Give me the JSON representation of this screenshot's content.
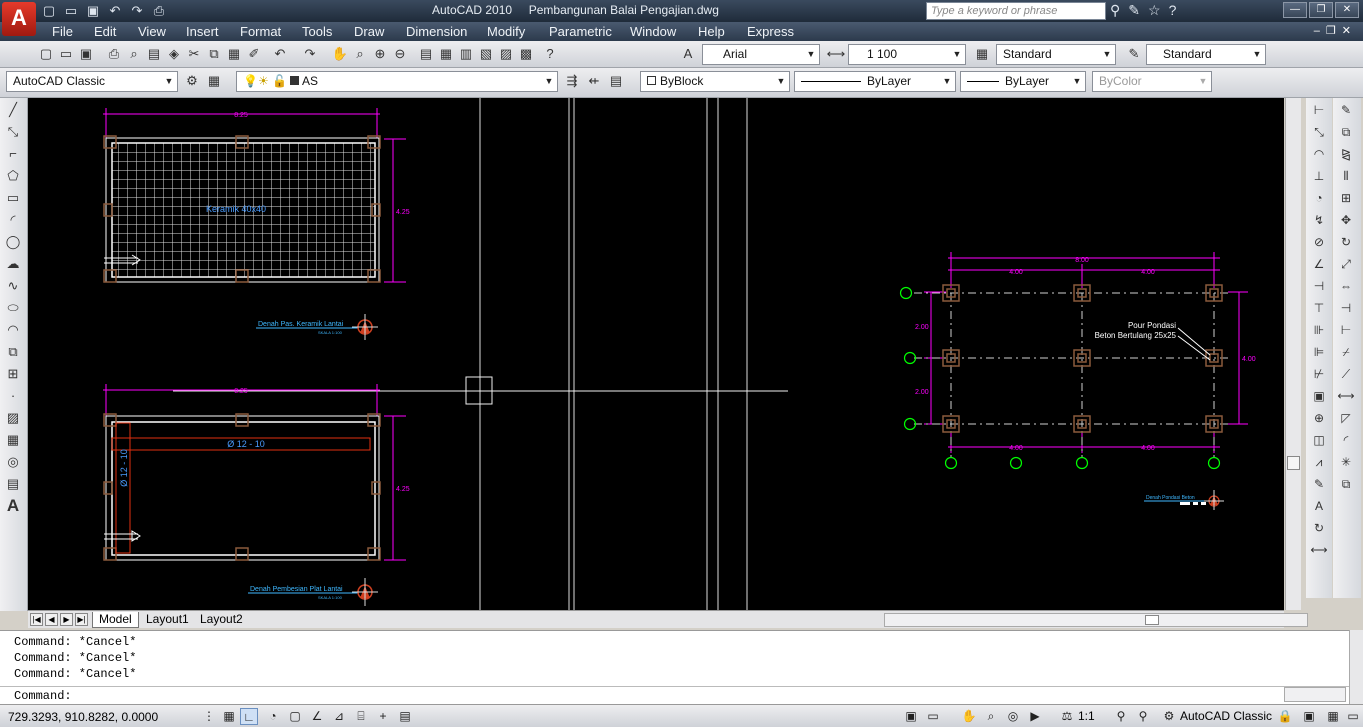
{
  "title_bar": {
    "app_name": "AutoCAD 2010",
    "file_name": "Pembangunan Balai Pengajian.dwg",
    "search_placeholder": "Type a keyword or phrase",
    "logo_letter": "A"
  },
  "menu": [
    "File",
    "Edit",
    "View",
    "Insert",
    "Format",
    "Tools",
    "Draw",
    "Dimension",
    "Modify",
    "Parametric",
    "Window",
    "Help",
    "Express"
  ],
  "styles_toolbar": {
    "font": "Arial",
    "scale": "1 100",
    "dim_style": "Standard",
    "table_style": "Standard"
  },
  "layers_toolbar": {
    "workspace": "AutoCAD Classic",
    "layer": "AS",
    "color": "ByBlock",
    "linetype": "ByLayer",
    "lineweight": "ByLayer",
    "plot_style": "ByColor"
  },
  "drawing": {
    "keramik": {
      "dim_top": "8.25",
      "dim_right": "4.25",
      "label": "Keramik 40x40",
      "caption": "Denah Pas. Keramik Lantai",
      "scale": "SKALA 1:100"
    },
    "plat": {
      "dim_top": "8.25",
      "dim_right": "4.25",
      "rebar_h": "Ø 12 - 10",
      "rebar_v": "Ø 12 - 10",
      "caption": "Denah Pembesian Plat Lantai",
      "scale": "SKALA 1:100"
    },
    "pondasi": {
      "dim_total": "8.00",
      "dim_left_half": "4.00",
      "dim_right_half": "4.00",
      "dim_bottom_left": "4.00",
      "dim_bottom_right": "4.00",
      "dim_left_top": "2.00",
      "dim_left_bottom": "2.00",
      "dim_right": "4.00",
      "callout_line1": "Pour Pondasi",
      "callout_line2": "Beton Bertulang 25x25",
      "caption": "Denah Pondasi Beton"
    }
  },
  "layout_tabs": [
    "Model",
    "Layout1",
    "Layout2"
  ],
  "command_history": [
    "Command: *Cancel*",
    "Command: *Cancel*",
    "Command: *Cancel*"
  ],
  "command_prompt": "Command:",
  "status": {
    "coordinates": "729.3293, 910.8282, 0.0000",
    "annotation_scale": "1:1",
    "workspace": "AutoCAD Classic"
  },
  "colors": {
    "canvas": "#000000",
    "dimension": "#ff00ff",
    "column": "#8b5a3c",
    "grid_bubble": "#00ff00",
    "text_blue": "#4a9cff",
    "caption": "#3fb8ff"
  }
}
